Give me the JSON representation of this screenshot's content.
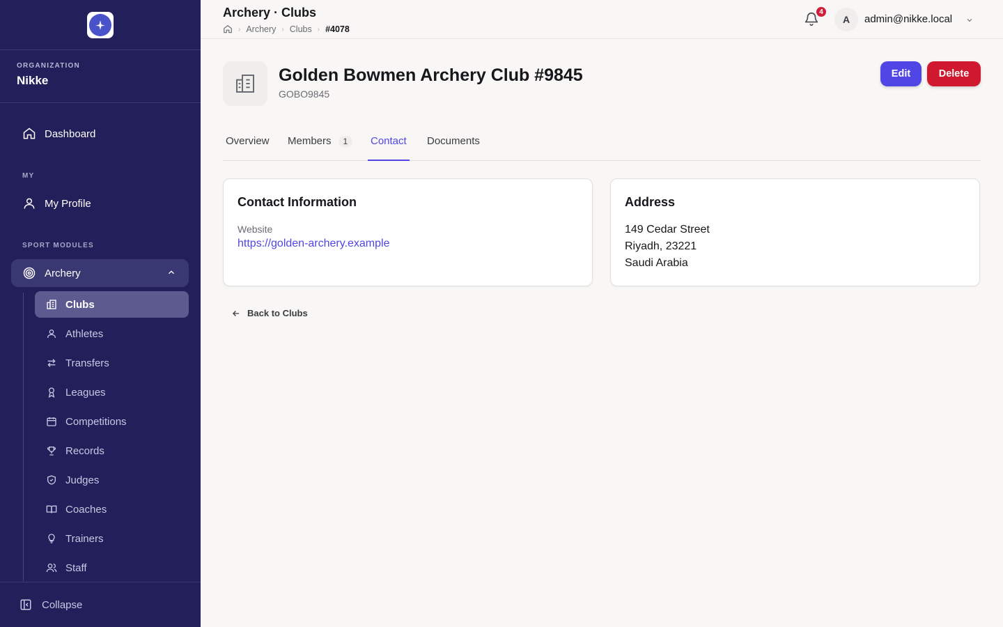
{
  "sidebar": {
    "org_label": "ORGANIZATION",
    "org_name": "Nikke",
    "dashboard_label": "Dashboard",
    "my_section": "MY",
    "my_profile_label": "My Profile",
    "sport_section": "SPORT MODULES",
    "archery_label": "Archery",
    "subitems": [
      {
        "label": "Clubs",
        "icon": "building-icon"
      },
      {
        "label": "Athletes",
        "icon": "user-icon"
      },
      {
        "label": "Transfers",
        "icon": "arrows-icon"
      },
      {
        "label": "Leagues",
        "icon": "award-icon"
      },
      {
        "label": "Competitions",
        "icon": "calendar-icon"
      },
      {
        "label": "Records",
        "icon": "trophy-icon"
      },
      {
        "label": "Judges",
        "icon": "shield-icon"
      },
      {
        "label": "Coaches",
        "icon": "book-icon"
      },
      {
        "label": "Trainers",
        "icon": "lightbulb-icon"
      },
      {
        "label": "Staff",
        "icon": "users-icon"
      }
    ],
    "collapse_label": "Collapse"
  },
  "header": {
    "title": "Archery · Clubs",
    "breadcrumbs": [
      "Archery",
      "Clubs",
      "#4078"
    ],
    "notification_count": "4",
    "avatar_initial": "A",
    "user_email": "admin@nikke.local"
  },
  "club": {
    "name": "Golden Bowmen Archery Club #9845",
    "code": "GOBO9845",
    "edit_label": "Edit",
    "delete_label": "Delete"
  },
  "tabs": [
    {
      "label": "Overview"
    },
    {
      "label": "Members",
      "count": "1"
    },
    {
      "label": "Contact",
      "active": true
    },
    {
      "label": "Documents"
    }
  ],
  "contact": {
    "title": "Contact Information",
    "website_label": "Website",
    "website_url": "https://golden-archery.example"
  },
  "address": {
    "title": "Address",
    "line1": "149 Cedar Street",
    "line2": "Riyadh, 23221",
    "line3": "Saudi Arabia"
  },
  "back_label": "Back to Clubs",
  "colors": {
    "sidebar_bg": "#221f5a",
    "accent": "#4f46e5",
    "danger": "#d0192f"
  }
}
